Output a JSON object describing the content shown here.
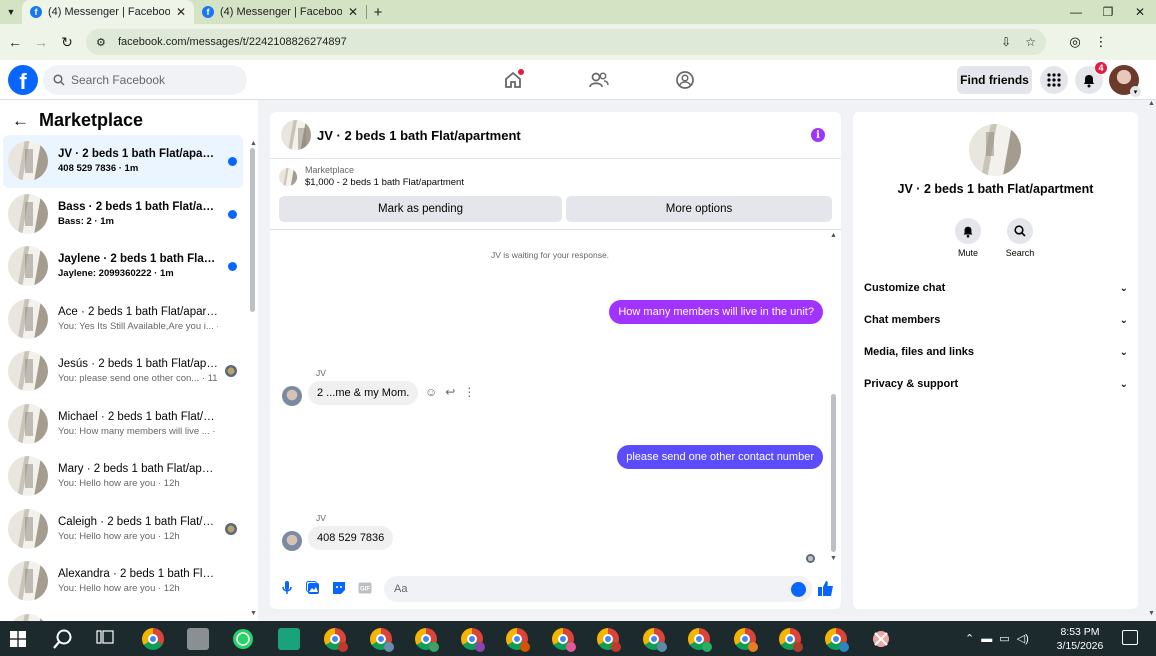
{
  "browser": {
    "tabs": [
      {
        "title": "(4) Messenger | Facebook",
        "close": "✕"
      },
      {
        "title": "(4) Messenger | Facebook",
        "close": "✕"
      }
    ],
    "url": "facebook.com/messages/t/2242108826274897"
  },
  "header": {
    "search_placeholder": "Search Facebook",
    "find_friends": "Find friends",
    "notification_count": "4"
  },
  "sidebar": {
    "title": "Marketplace",
    "conversations": [
      {
        "name": "JV · 2 beds 1 bath Flat/apartm...",
        "preview": "408 529 7836 · 1m",
        "unread": true,
        "active": true
      },
      {
        "name": "Bass · 2 beds 1 bath Flat/apart...",
        "preview": "Bass: 2 · 1m",
        "unread": true
      },
      {
        "name": "Jaylene · 2 beds 1 bath Flat/ap...",
        "preview": "Jaylene: 2099360222 · 1m",
        "unread": true
      },
      {
        "name": "Ace · 2 beds 1 bath Flat/apartme...",
        "preview": "You: Yes Its Still Available,Are you i... · 1m"
      },
      {
        "name": "Jesús · 2 beds 1 bath Flat/apar...",
        "preview": "You: please send one other con... · 11h",
        "seen_avatar": true
      },
      {
        "name": "Michael · 2 beds 1 bath Flat/apar...",
        "preview": "You: How many members will live ... · 11h"
      },
      {
        "name": "Mary · 2 beds 1 bath Flat/apart...",
        "preview": "You: Hello how are you · 12h"
      },
      {
        "name": "Caleigh · 2 beds 1 bath Flat/ap...",
        "preview": "You: Hello how are you · 12h",
        "seen_avatar": true
      },
      {
        "name": "Alexandra · 2 beds 1 bath Flat/a...",
        "preview": "You: Hello how are you · 12h"
      },
      {
        "name": "Alexandra · 2 beds 1 bath Flat/...",
        "preview": ""
      }
    ]
  },
  "chat": {
    "title": "JV · 2 beds 1 bath Flat/apartment",
    "marketplace_label": "Marketplace",
    "listing": "$1,000 - 2 beds 1 bath Flat/apartment",
    "mark_pending": "Mark as pending",
    "more_options": "More options",
    "waiting_notice": "JV is waiting for your response.",
    "messages": [
      {
        "from": "me",
        "text": "How many members will live in the unit?",
        "color": "#a033ff"
      },
      {
        "from": "JV",
        "sender_label": "JV",
        "text": "2 ...me & my Mom."
      },
      {
        "from": "me",
        "text": "please send one other contact number",
        "color": "#5b4cff"
      },
      {
        "from": "JV",
        "sender_label": "JV",
        "text": "408 529 7836"
      }
    ],
    "composer_placeholder": "Aa"
  },
  "info_panel": {
    "name": "JV · 2 beds 1 bath Flat/apartment",
    "mute_label": "Mute",
    "search_label": "Search",
    "sections": [
      "Customize chat",
      "Chat members",
      "Media, files and links",
      "Privacy & support"
    ]
  },
  "taskbar": {
    "time": "8:53 PM",
    "date": "3/15/2026"
  },
  "colors": {
    "accent": "#0866ff",
    "info_purple": "#a033ff",
    "unread_dot": "#0866ff",
    "badge_red": "#e41e3f"
  }
}
